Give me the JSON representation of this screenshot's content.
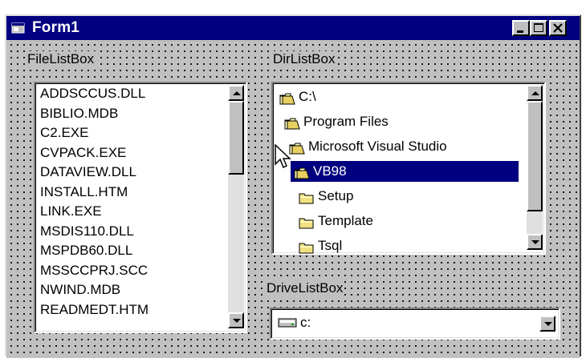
{
  "window": {
    "title": "Form1",
    "buttons": [
      "minimize",
      "maximize",
      "close"
    ]
  },
  "file_list": {
    "label": "FileListBox",
    "items": [
      "ADDSCCUS.DLL",
      "BIBLIO.MDB",
      "C2.EXE",
      "CVPACK.EXE",
      "DATAVIEW.DLL",
      "INSTALL.HTM",
      "LINK.EXE",
      "MSDIS110.DLL",
      "MSPDB60.DLL",
      "MSSCCPRJ.SCC",
      "NWIND.MDB",
      "READMEDT.HTM"
    ]
  },
  "dir_list": {
    "label": "DirListBox",
    "items": [
      {
        "label": "C:\\",
        "icon": "folder-open-icon",
        "selected": false
      },
      {
        "label": "Program Files",
        "icon": "folder-open-icon",
        "selected": false
      },
      {
        "label": "Microsoft Visual Studio",
        "icon": "folder-open-icon",
        "selected": false
      },
      {
        "label": "VB98",
        "icon": "folder-open-icon",
        "selected": true
      },
      {
        "label": "Setup",
        "icon": "folder-closed-icon",
        "selected": false
      },
      {
        "label": "Template",
        "icon": "folder-closed-icon",
        "selected": false
      },
      {
        "label": "Tsql",
        "icon": "folder-closed-icon",
        "selected": false
      }
    ]
  },
  "drive_list": {
    "label": "DriveListBox",
    "value": "c:",
    "icon": "drive-icon"
  },
  "colors": {
    "titlebar": "#000080",
    "face": "#c0c0c0",
    "selection": "#000080"
  }
}
